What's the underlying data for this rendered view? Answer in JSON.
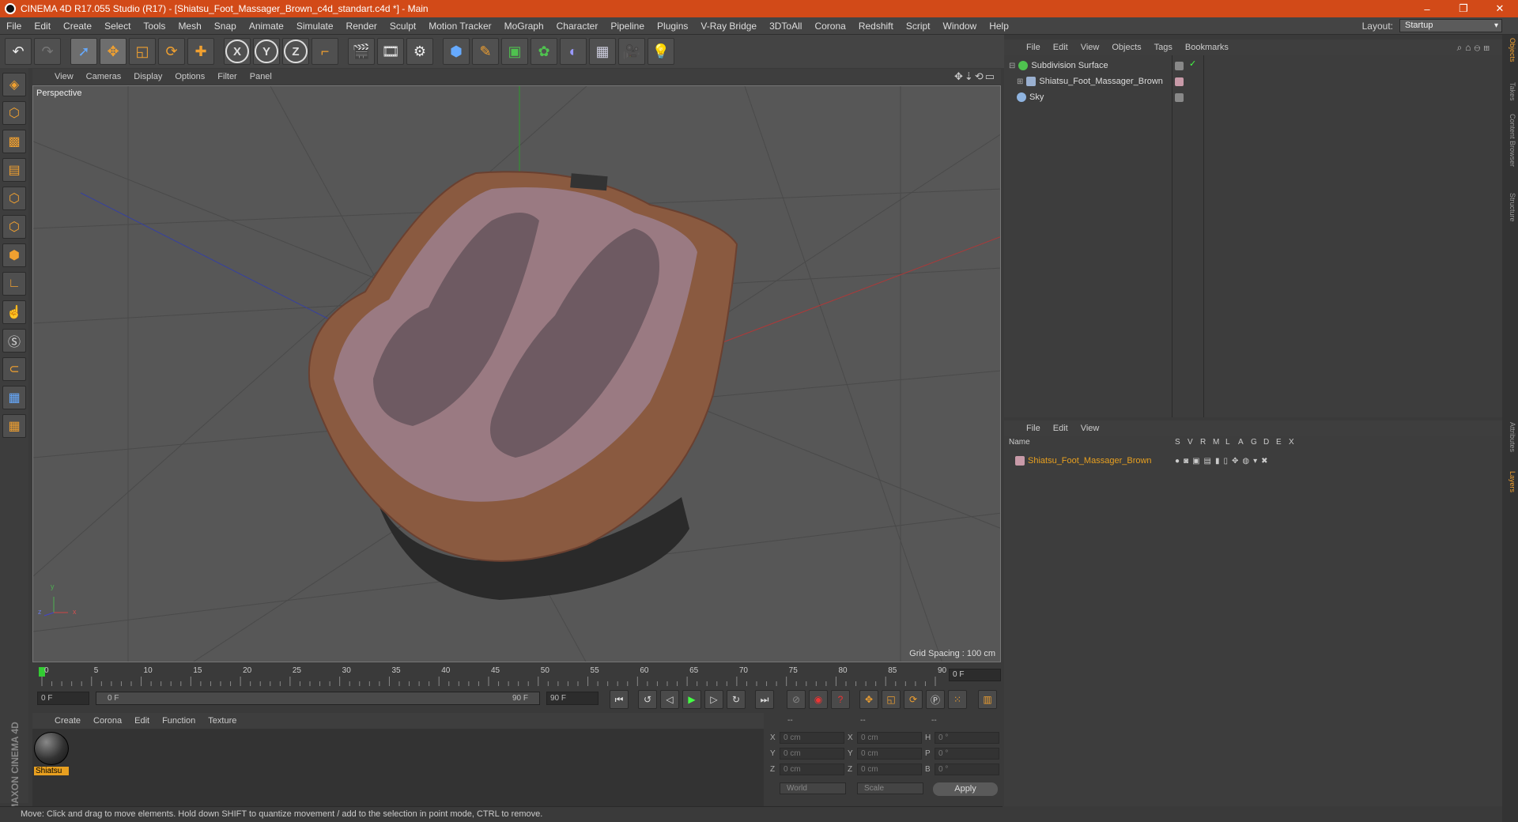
{
  "window": {
    "title": "CINEMA 4D R17.055 Studio (R17) - [Shiatsu_Foot_Massager_Brown_c4d_standart.c4d *] - Main",
    "minimize": "–",
    "restore": "❐",
    "close": "✕"
  },
  "menubar": {
    "items": [
      "File",
      "Edit",
      "Create",
      "Select",
      "Tools",
      "Mesh",
      "Snap",
      "Animate",
      "Simulate",
      "Render",
      "Sculpt",
      "Motion Tracker",
      "MoGraph",
      "Character",
      "Pipeline",
      "Plugins",
      "V-Ray Bridge",
      "3DToAll",
      "Corona",
      "Redshift",
      "Script",
      "Window",
      "Help"
    ],
    "layout_label": "Layout:",
    "layout_value": "Startup"
  },
  "toolbar": {
    "icons": [
      "undo-icon",
      "redo-icon",
      "select-icon",
      "move-icon",
      "scale-icon",
      "rotate-icon",
      "add-icon",
      "x-axis-icon",
      "y-axis-icon",
      "z-axis-icon",
      "coordinate-system-icon",
      "render-region-icon",
      "render-view-icon",
      "render-settings-icon",
      "cube-icon",
      "pen-icon",
      "subdivision-icon",
      "cloner-icon",
      "deformer-icon",
      "floor-icon",
      "camera-icon",
      "light-icon"
    ],
    "axis_x": "X",
    "axis_y": "Y",
    "axis_z": "Z"
  },
  "viewport": {
    "menu": [
      "View",
      "Cameras",
      "Display",
      "Options",
      "Filter",
      "Panel"
    ],
    "label": "Perspective",
    "grid_spacing": "Grid Spacing : 100 cm",
    "axis_y": "y",
    "axis_z": "z",
    "axis_x": "x"
  },
  "timeline": {
    "ticks": [
      "0",
      "5",
      "10",
      "15",
      "20",
      "25",
      "30",
      "35",
      "40",
      "45",
      "50",
      "55",
      "60",
      "65",
      "70",
      "75",
      "80",
      "85",
      "90"
    ],
    "current_frame": "0 F"
  },
  "transport": {
    "start_field": "0 F",
    "range_start": "0 F",
    "range_end": "90 F",
    "end_field": "90 F"
  },
  "material_manager": {
    "menu": [
      "Create",
      "Corona",
      "Edit",
      "Function",
      "Texture"
    ],
    "material_name": "Shiatsu"
  },
  "logo": "MAXON CINEMA 4D",
  "coordinates": {
    "header_dashes": [
      "--",
      "--",
      "--"
    ],
    "rows": [
      {
        "a": "X",
        "av": "0 cm",
        "b": "X",
        "bv": "0 cm",
        "c": "H",
        "cv": "0 °"
      },
      {
        "a": "Y",
        "av": "0 cm",
        "b": "Y",
        "bv": "0 cm",
        "c": "P",
        "cv": "0 °"
      },
      {
        "a": "Z",
        "av": "0 cm",
        "b": "Z",
        "bv": "0 cm",
        "c": "B",
        "cv": "0 °"
      }
    ],
    "space": "World",
    "mode": "Scale",
    "apply": "Apply"
  },
  "status": "Move: Click and drag to move elements. Hold down SHIFT to quantize movement / add to the selection in point mode, CTRL to remove.",
  "object_manager": {
    "menu": [
      "File",
      "Edit",
      "View",
      "Objects",
      "Tags",
      "Bookmarks"
    ],
    "objects": [
      {
        "name": "Subdivision Surface",
        "color": "#4fc24f"
      },
      {
        "name": "Shiatsu_Foot_Massager_Brown",
        "color": "#9ab0d0"
      },
      {
        "name": "Sky",
        "color": "#8fb4e0"
      }
    ]
  },
  "layer_manager": {
    "menu": [
      "File",
      "Edit",
      "View"
    ],
    "columns": [
      "Name",
      "S",
      "V",
      "R",
      "M",
      "L",
      "A",
      "G",
      "D",
      "E",
      "X"
    ],
    "layers": [
      {
        "name": "Shiatsu_Foot_Massager_Brown",
        "color": "#e8a020"
      }
    ]
  },
  "right_tabs": [
    "Objects",
    "Takes",
    "Content Browser",
    "Structure",
    "Attributes",
    "Layers"
  ]
}
